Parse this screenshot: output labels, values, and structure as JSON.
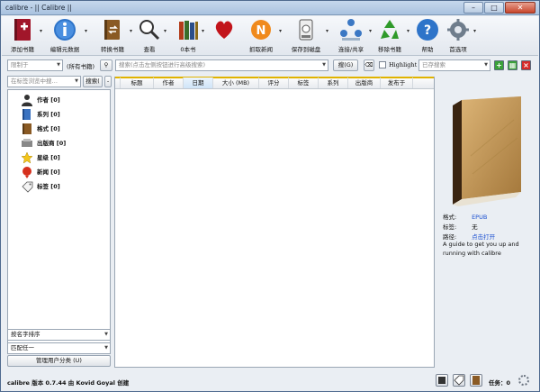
{
  "window": {
    "title": "calibre - || Calibre ||",
    "controls": [
      "–",
      "□",
      "✕"
    ]
  },
  "toolbar": {
    "items": [
      {
        "name": "add-books",
        "label": "添加书籍",
        "icon": "add-book-icon"
      },
      {
        "name": "edit-metadata",
        "label": "编辑元数据",
        "icon": "info-icon"
      },
      {
        "name": "convert-books",
        "label": "转换书籍",
        "icon": "convert-icon"
      },
      {
        "name": "view",
        "label": "查看",
        "icon": "magnifier-icon"
      },
      {
        "name": "get-books",
        "label": "0本书",
        "icon": "heart-icon"
      },
      {
        "name": "fetch-news",
        "label": "抓取新闻",
        "icon": "news-icon"
      },
      {
        "name": "save-to-disk",
        "label": "保存到磁盘",
        "icon": "disk-icon"
      },
      {
        "name": "connect-share",
        "label": "连接/共享",
        "icon": "network-icon"
      },
      {
        "name": "remove-books",
        "label": "移除书籍",
        "icon": "recycle-icon"
      },
      {
        "name": "help",
        "label": "帮助",
        "icon": "help-icon"
      },
      {
        "name": "preferences",
        "label": "首选项",
        "icon": "gear-icon"
      }
    ]
  },
  "search": {
    "restrict_label": "限制于",
    "all_books_label": "(所有书籍)",
    "placeholder": "搜索(点击左侧按钮进行高级搜索)",
    "search_button": "搜(G)",
    "highlight_label": "Highlight",
    "saved_search_placeholder": "已存搜索"
  },
  "left_pane": {
    "find_placeholder": "在标签浏览中搜…",
    "find_button": "搜索(",
    "tags": [
      {
        "label": "作者 [0]",
        "icon": "person-icon"
      },
      {
        "label": "系列 [0]",
        "icon": "series-icon"
      },
      {
        "label": "格式 [0]",
        "icon": "book-icon"
      },
      {
        "label": "出版商 [0]",
        "icon": "publisher-icon"
      },
      {
        "label": "星级 [0]",
        "icon": "star-icon"
      },
      {
        "label": "新闻 [0]",
        "icon": "news-icon"
      },
      {
        "label": "标签 [0]",
        "icon": "tag-icon"
      }
    ],
    "sort_by": "按名字排序",
    "match": "匹配任一",
    "manage_button": "管理用户分类 (U)"
  },
  "table": {
    "columns": [
      "标题",
      "作者",
      "日期",
      "大小 (MB)",
      "评分",
      "标签",
      "系列",
      "出版商",
      "发布于"
    ],
    "selected_column": "日期",
    "rows": []
  },
  "details": {
    "rows": [
      {
        "key": "格式:",
        "value": "EPUB",
        "link": true
      },
      {
        "key": "标签:",
        "value": "无",
        "link": false
      },
      {
        "key": "路径:",
        "value": "点击打开",
        "link": true
      }
    ],
    "description": "A guide to get you up and running with calibre"
  },
  "status": {
    "text": "calibre 版本 0.7.44 由 Kovid Goyal 创建",
    "jobs_label": "任务：0"
  },
  "colors": {
    "accent": "#e0b300",
    "link": "#1a4fd0",
    "titlebar": "#a9c2df"
  }
}
